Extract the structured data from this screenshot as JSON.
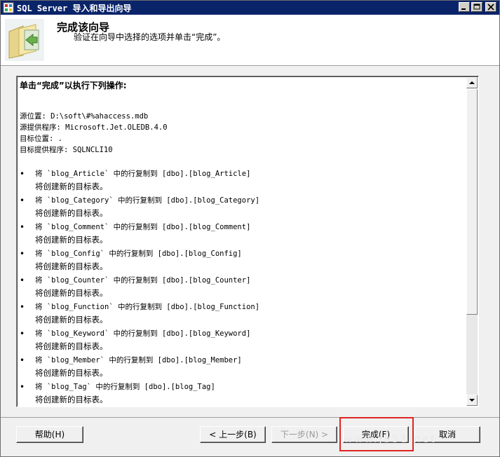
{
  "window": {
    "title": "SQL Server 导入和导出向导"
  },
  "header": {
    "title": "完成该向导",
    "subtitle": "验证在向导中选择的选项并单击“完成”。"
  },
  "content": {
    "heading": "单击“完成”以执行下列操作:",
    "info": [
      "源位置: D:\\soft\\#%ahaccess.mdb",
      "源提供程序: Microsoft.Jet.OLEDB.4.0",
      "目标位置: .",
      "目标提供程序: SQLNCLI10"
    ],
    "bullet": "•",
    "items": [
      {
        "copy": "将 `blog_Article` 中的行复制到 [dbo].[blog_Article]",
        "note": "将创建新的目标表。"
      },
      {
        "copy": "将 `blog_Category` 中的行复制到 [dbo].[blog_Category]",
        "note": "将创建新的目标表。"
      },
      {
        "copy": "将 `blog_Comment` 中的行复制到 [dbo].[blog_Comment]",
        "note": "将创建新的目标表。"
      },
      {
        "copy": "将 `blog_Config` 中的行复制到 [dbo].[blog_Config]",
        "note": "将创建新的目标表。"
      },
      {
        "copy": "将 `blog_Counter` 中的行复制到 [dbo].[blog_Counter]",
        "note": "将创建新的目标表。"
      },
      {
        "copy": "将 `blog_Function` 中的行复制到 [dbo].[blog_Function]",
        "note": "将创建新的目标表。"
      },
      {
        "copy": "将 `blog_Keyword` 中的行复制到 [dbo].[blog_Keyword]",
        "note": "将创建新的目标表。"
      },
      {
        "copy": "将 `blog_Member` 中的行复制到 [dbo].[blog_Member]",
        "note": "将创建新的目标表。"
      },
      {
        "copy": "将 `blog_Tag` 中的行复制到 [dbo].[blog_Tag]",
        "note": "将创建新的目标表。"
      }
    ]
  },
  "buttons": {
    "help": "帮助(H)",
    "back": "< 上一步(B)",
    "next": "下一步(N) >",
    "finish": "完成(F)",
    "cancel": "取消"
  },
  "watermark": "www.jb51.net",
  "colors": {
    "titlebar": "#0a246a",
    "highlight": "#e02424"
  }
}
